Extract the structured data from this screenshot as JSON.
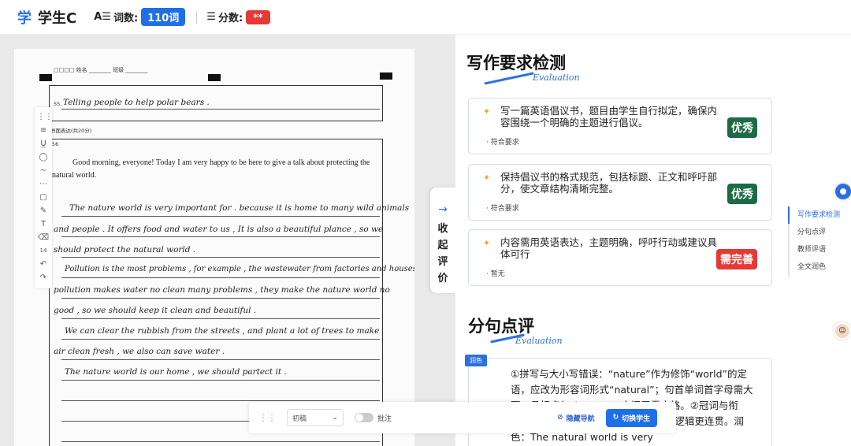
{
  "header": {
    "brand_char": "学",
    "student_name": "学生C",
    "word_count_label": "词数:",
    "word_count": "110词",
    "score_label": "分数:",
    "score": "**"
  },
  "paper": {
    "header_text": "□□□□ 姓名 ________ 班级 ________",
    "q55_num": "55.",
    "q55_answer": "Telling people to help polar bears .",
    "section_label": "书面表达(共20分)",
    "q56_num": "56",
    "printed_intro": "Good morning, everyone! Today I am very happy to be here to give a talk about protecting the natural world.",
    "lines": [
      "The nature world is very important for . because it is home to many wild animals",
      "and people . It offers food and water to us , It is also a beautiful plance , so we",
      "should protect the natural world .",
      "Pollution is the most problems , for example , the wastewater from factories and houses,",
      "pollution makes water no clean many problems , they make the nature world no",
      "good , so we should keep it clean and beautiful .",
      "We can clear the rubbish from the streets , and plant a lot of trees to make",
      "air clean fresh , we also can save water .",
      "The nature world is our home , we should partect it ."
    ],
    "tool_number": "14"
  },
  "toolbar": {
    "draft_select": "初稿",
    "annotate_label": "批注",
    "hide_nav_label": "隐藏导航",
    "switch_student_label": "切换学生"
  },
  "collapse_tab": {
    "chars": [
      "收",
      "起",
      "评",
      "价"
    ]
  },
  "requirements": {
    "title": "写作要求检测",
    "script": "Evaluation",
    "items": [
      {
        "text": "写一篇英语倡议书，题目由学生自行拟定，确保内容围绕一个明确的主题进行倡议。",
        "note": "符合要求",
        "tag": "优秀"
      },
      {
        "text": "保持倡议书的格式规范，包括标题、正文和呼吁部分，使文章结构清晰完整。",
        "note": "符合要求",
        "tag": "优秀"
      },
      {
        "text": "内容需用英语表达，主题明确，呼吁行动或建议具体可行",
        "note": "暂无",
        "tag": "需完善"
      }
    ]
  },
  "sentence_review": {
    "title": "分句点评",
    "script": "Evaluation",
    "tag": "润色",
    "text": "①拼写与大小写错误：“nature”作为修饰“world”的定语，应改为形容词形式“natural”；句首单词首字母需大写，且标点与“because”之间无需空格。②冠词与衔接：…………替代更贴合前文的us”，逻辑更连贯。润色：The natural world is very"
  },
  "nav": {
    "items": [
      "写作要求检测",
      "分句点评",
      "教师评语",
      "全文润色"
    ]
  },
  "colors": {
    "accent": "#1e6fe8",
    "excellent": "#1c6b45",
    "needs_work": "#e53935"
  }
}
